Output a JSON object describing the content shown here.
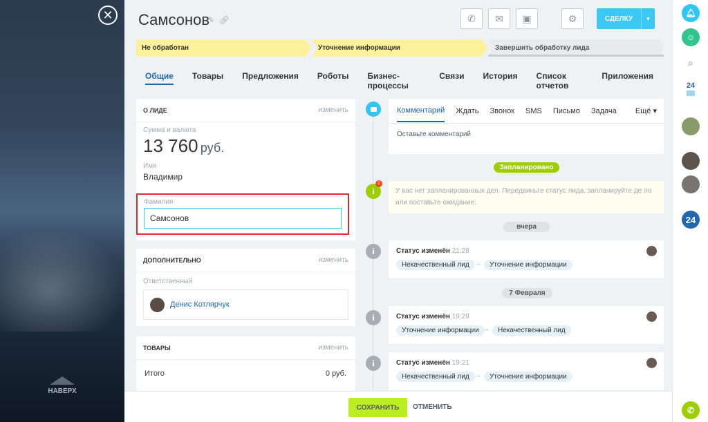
{
  "page": {
    "title": "Самсонов",
    "back_to_top": "НАВЕРХ"
  },
  "toolbar": {
    "convert_label": "СДЕЛКУ"
  },
  "stages": [
    "Не обработан",
    "Уточнение информации",
    "Завершить обработку лида"
  ],
  "tabs": [
    "Общие",
    "Товары",
    "Предложения",
    "Роботы",
    "Бизнес-процессы",
    "Связи",
    "История",
    "Список отчетов",
    "Приложения"
  ],
  "about": {
    "title": "О ЛИДЕ",
    "edit": "изменить",
    "amount_label": "Сумма и валюта",
    "amount": "13 760",
    "currency": "руб.",
    "name_label": "Имя",
    "name": "Владимир",
    "surname_label": "Фамилия",
    "surname": "Самсонов"
  },
  "extra": {
    "title": "ДОПОЛНИТЕЛЬНО",
    "edit": "изменить",
    "responsible_label": "Ответственный",
    "responsible": "Денис Котлярчук"
  },
  "goods": {
    "title": "ТОВАРЫ",
    "edit": "изменить",
    "total_label": "Итого",
    "total": "0 руб."
  },
  "activity": {
    "tabs": [
      "Комментарий",
      "Ждать",
      "Звонок",
      "SMS",
      "Письмо",
      "Задача"
    ],
    "more": "Ещё",
    "placeholder": "Оставьте комментарий"
  },
  "timeline": {
    "planned": "Запланировано",
    "badge": "1",
    "notice": "У вас нет запланированных дел. Передвиньте статус лида, запланируйте де ло или поставьте ожидание.",
    "yesterday": "вчера",
    "feb": "7 Февраля",
    "items": [
      {
        "title": "Статус изменён",
        "time": "21:28",
        "from": "Некачественный лид",
        "to": "Уточнение информации"
      },
      {
        "title": "Статус изменён",
        "time": "19:29",
        "from": "Уточнение информации",
        "to": "Некачественный лид"
      },
      {
        "title": "Статус изменён",
        "time": "19:21",
        "from": "Некачественный лид",
        "to": "Уточнение информации"
      }
    ]
  },
  "footer": {
    "save": "СОХРАНИТЬ",
    "cancel": "ОТМЕНИТЬ"
  },
  "rightbar": {
    "b24_label": "24",
    "b24_round": "24"
  },
  "colors": {
    "accent": "#3bc8f5",
    "stage_yellow": "#fdf29b",
    "save_green": "#bbed21",
    "tab_active": "#2067b0"
  }
}
